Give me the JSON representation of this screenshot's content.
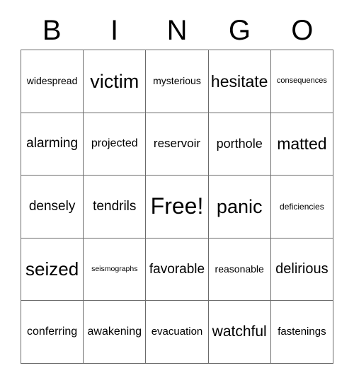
{
  "card": {
    "title": "BINGO",
    "header_letters": [
      "B",
      "I",
      "N",
      "G",
      "O"
    ],
    "colors": {
      "grid_line": "#6b6b6b",
      "text": "#000000",
      "background": "#ffffff"
    },
    "rows": [
      [
        {
          "label": "widespread",
          "font_size": "14px"
        },
        {
          "label": "victim",
          "font_size": "27px"
        },
        {
          "label": "mysterious",
          "font_size": "14px"
        },
        {
          "label": "hesitate",
          "font_size": "23px"
        },
        {
          "label": "consequences",
          "font_size": "11px"
        }
      ],
      [
        {
          "label": "alarming",
          "font_size": "19px"
        },
        {
          "label": "projected",
          "font_size": "16px"
        },
        {
          "label": "reservoir",
          "font_size": "17px"
        },
        {
          "label": "porthole",
          "font_size": "18px"
        },
        {
          "label": "matted",
          "font_size": "23px"
        }
      ],
      [
        {
          "label": "densely",
          "font_size": "19px"
        },
        {
          "label": "tendrils",
          "font_size": "19px"
        },
        {
          "label": "Free!",
          "font_size": "32px"
        },
        {
          "label": "panic",
          "font_size": "27px"
        },
        {
          "label": "deficiencies",
          "font_size": "12px"
        }
      ],
      [
        {
          "label": "seized",
          "font_size": "26px"
        },
        {
          "label": "seismographs",
          "font_size": "10.5px"
        },
        {
          "label": "favorable",
          "font_size": "19px"
        },
        {
          "label": "reasonable",
          "font_size": "14px"
        },
        {
          "label": "delirious",
          "font_size": "20px"
        }
      ],
      [
        {
          "label": "conferring",
          "font_size": "16px"
        },
        {
          "label": "awakening",
          "font_size": "16px"
        },
        {
          "label": "evacuation",
          "font_size": "15px"
        },
        {
          "label": "watchful",
          "font_size": "21px"
        },
        {
          "label": "fastenings",
          "font_size": "15px"
        }
      ]
    ]
  }
}
